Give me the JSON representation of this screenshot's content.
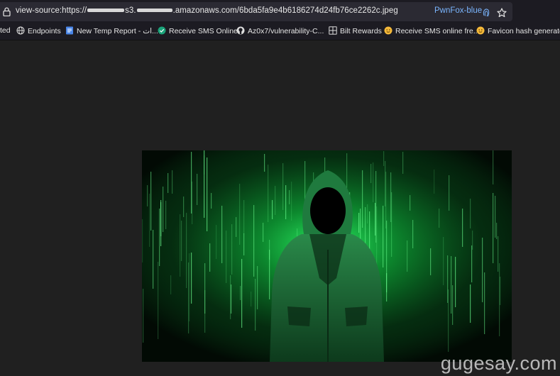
{
  "browser": {
    "url_prefix": "view-source:https://",
    "url_mid": "s3.",
    "url_suffix": ".amazonaws.com/6bda5fa9e4b6186274d24fb76ce2262c.jpeg",
    "container_label": "PwnFox-blue",
    "colors": {
      "toolbar": "#1c1b22",
      "urlbar": "#2b2a33",
      "container": "#7bb6ff"
    }
  },
  "bookmarks": [
    {
      "label": "ted",
      "icon": "none"
    },
    {
      "label": "Endpoints",
      "icon": "globe-icon"
    },
    {
      "label": "New Temp Report - ات...",
      "icon": "doc-icon"
    },
    {
      "label": "Receive SMS Online",
      "icon": "sms-icon"
    },
    {
      "label": "Az0x7/vulnerability-C...",
      "icon": "github-icon"
    },
    {
      "label": "Bilt Rewards",
      "icon": "grid-icon"
    },
    {
      "label": "Receive SMS online fre...",
      "icon": "emoji-icon"
    },
    {
      "label": "Favicon hash generator",
      "icon": "emoji-icon"
    }
  ],
  "image": {
    "subject": "hooded figure with green code rain",
    "accent": "#22ff55"
  },
  "watermark": "gugesay.com"
}
